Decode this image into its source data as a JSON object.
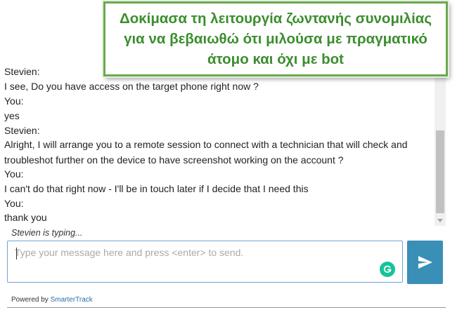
{
  "caption": {
    "lines": [
      "Δοκίμασα τη λειτουργία ζωντανής συνομιλίας",
      "για να βεβαιωθώ ότι μιλούσα με πραγματικό",
      "άτομο και όχι με bot"
    ],
    "color": "#3b8e2e",
    "border_color": "#6aa84f"
  },
  "transcript": [
    {
      "text": "Stevien:"
    },
    {
      "text": "I see, Do you have access on the target phone right now ?"
    },
    {
      "text": "You:"
    },
    {
      "text": "yes"
    },
    {
      "text": "Stevien:"
    },
    {
      "text": "Alright, I will arrange you to a remote session to connect with a technician that will check and troubleshot further on the device to have screenshot working on the account ?"
    },
    {
      "text": "You:"
    },
    {
      "text": "I can't do that right now - I'll be in touch later if I decide that I need this"
    },
    {
      "text": "You:"
    },
    {
      "text": "thank you"
    }
  ],
  "typing_indicator": "Stevien is typing...",
  "input": {
    "placeholder": "Type your message here and press <enter> to send.",
    "value": ""
  },
  "send_button": {
    "icon": "send-icon",
    "color": "#3a8fb7"
  },
  "grammarly": {
    "icon": "grammarly-icon",
    "color": "#15c39a"
  },
  "footer": {
    "powered_by": "Powered by",
    "brand": "SmarterTrack"
  }
}
